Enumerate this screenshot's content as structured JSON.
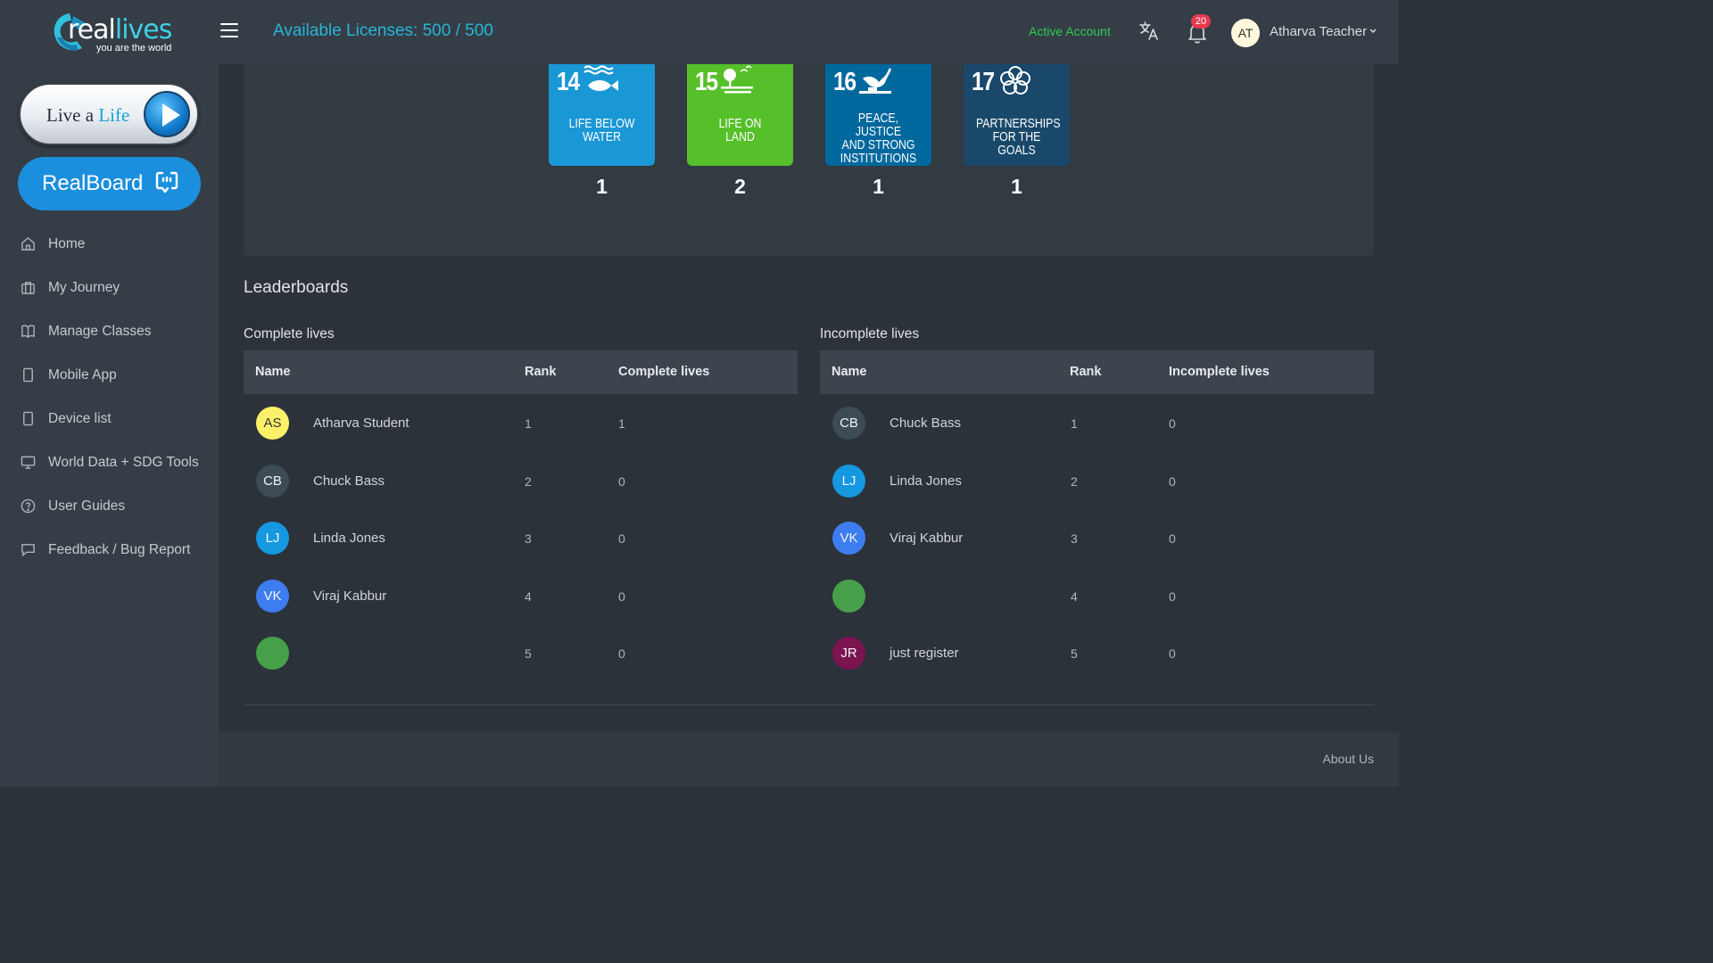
{
  "brand": {
    "logo_real": "real",
    "logo_lives": "lives",
    "tagline": "you are the world"
  },
  "sidebar": {
    "live_a_life": {
      "prefix": "Live a",
      "highlight": "Life"
    },
    "realboard_label": "RealBoard",
    "items": [
      {
        "label": "Home",
        "icon": "home-icon"
      },
      {
        "label": "My Journey",
        "icon": "briefcase-icon"
      },
      {
        "label": "Manage Classes",
        "icon": "book-icon"
      },
      {
        "label": "Mobile App",
        "icon": "mobile-icon"
      },
      {
        "label": "Device list",
        "icon": "device-icon"
      },
      {
        "label": "World Data + SDG Tools",
        "icon": "monitor-icon"
      },
      {
        "label": "User Guides",
        "icon": "help-circle-icon"
      },
      {
        "label": "Feedback / Bug Report",
        "icon": "message-icon"
      }
    ]
  },
  "topbar": {
    "licenses": "Available Licenses: 500 / 500",
    "account_status": "Active Account",
    "notification_count": "20",
    "user_initials": "AT",
    "user_name": "Atharva Teacher"
  },
  "sdg_goals": [
    {
      "number": "14",
      "title_line1": "Life below",
      "title_line2": "water",
      "title_line3": "",
      "count": "1",
      "color": "#1a97d5"
    },
    {
      "number": "15",
      "title_line1": "Life on",
      "title_line2": "land",
      "title_line3": "",
      "count": "2",
      "color": "#56c02b"
    },
    {
      "number": "16",
      "title_line1": "Peace, justice",
      "title_line2": "and strong",
      "title_line3": "institutions",
      "count": "1",
      "color": "#00689d"
    },
    {
      "number": "17",
      "title_line1": "Partnerships",
      "title_line2": "for the goals",
      "title_line3": "",
      "count": "1",
      "color": "#19486a"
    }
  ],
  "leaderboards": {
    "heading": "Leaderboards",
    "complete": {
      "title": "Complete lives",
      "columns": [
        "Name",
        "Rank",
        "Complete lives"
      ],
      "rows": [
        {
          "initials": "AS",
          "name": "Atharva Student",
          "rank": "1",
          "value": "1",
          "avatar_color": "#fff06a",
          "avatar_text_color": "#333333"
        },
        {
          "initials": "CB",
          "name": "Chuck Bass",
          "rank": "2",
          "value": "0",
          "avatar_color": "#3d4b55",
          "avatar_text_color": "#f2f4f6"
        },
        {
          "initials": "LJ",
          "name": "Linda Jones",
          "rank": "3",
          "value": "0",
          "avatar_color": "#1598e0",
          "avatar_text_color": "#f2f4f6"
        },
        {
          "initials": "VK",
          "name": "Viraj Kabbur",
          "rank": "4",
          "value": "0",
          "avatar_color": "#3d7df0",
          "avatar_text_color": "#f2f4f6"
        },
        {
          "initials": "",
          "name": "",
          "rank": "5",
          "value": "0",
          "avatar_color": "#46a04a",
          "avatar_text_color": "#f2f4f6"
        }
      ]
    },
    "incomplete": {
      "title": "Incomplete lives",
      "columns": [
        "Name",
        "Rank",
        "Incomplete lives"
      ],
      "rows": [
        {
          "initials": "CB",
          "name": "Chuck Bass",
          "rank": "1",
          "value": "0",
          "avatar_color": "#3d4b55",
          "avatar_text_color": "#f2f4f6"
        },
        {
          "initials": "LJ",
          "name": "Linda Jones",
          "rank": "2",
          "value": "0",
          "avatar_color": "#1598e0",
          "avatar_text_color": "#f2f4f6"
        },
        {
          "initials": "VK",
          "name": "Viraj Kabbur",
          "rank": "3",
          "value": "0",
          "avatar_color": "#3d7df0",
          "avatar_text_color": "#f2f4f6"
        },
        {
          "initials": "",
          "name": "",
          "rank": "4",
          "value": "0",
          "avatar_color": "#46a04a",
          "avatar_text_color": "#f2f4f6"
        },
        {
          "initials": "JR",
          "name": "just register",
          "rank": "5",
          "value": "0",
          "avatar_color": "#7b1450",
          "avatar_text_color": "#f2f4f6"
        }
      ]
    }
  },
  "footer": {
    "about": "About Us"
  }
}
